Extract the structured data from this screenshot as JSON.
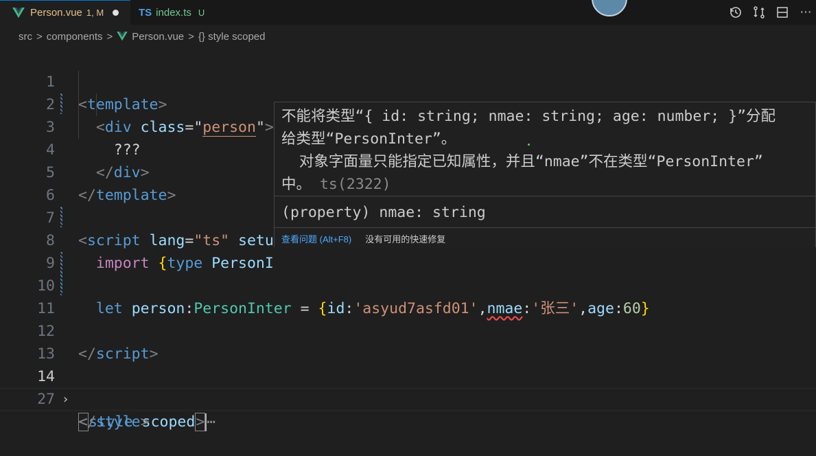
{
  "tabs": [
    {
      "label": "Person.vue",
      "status": "1, M",
      "icon": "vue-icon",
      "active": true
    },
    {
      "label": "index.ts",
      "status": "U",
      "icon_text": "TS"
    }
  ],
  "breadcrumb": {
    "items": [
      "src",
      "components",
      "Person.vue",
      "{} style scoped"
    ],
    "separator": ">"
  },
  "lines": [
    {
      "n": "1"
    },
    {
      "n": "2"
    },
    {
      "n": "3"
    },
    {
      "n": "4"
    },
    {
      "n": "5"
    },
    {
      "n": "6"
    },
    {
      "n": "7"
    },
    {
      "n": "8"
    },
    {
      "n": "9"
    },
    {
      "n": "10"
    },
    {
      "n": "11"
    },
    {
      "n": "12"
    },
    {
      "n": "13"
    },
    {
      "n": "14"
    },
    {
      "n": "27"
    }
  ],
  "code": {
    "l1": {
      "open": "<",
      "name": "template",
      "close": ">"
    },
    "l2": {
      "open": "<",
      "name": "div",
      "attr": "class",
      "eq": "=\"",
      "val": "person",
      "endq": "\"",
      "close": ">"
    },
    "l3": {
      "text": "???"
    },
    "l4": {
      "open": "</",
      "name": "div",
      "close": ">"
    },
    "l5": {
      "open": "</",
      "name": "template",
      "close": ">"
    },
    "l7": {
      "open": "<",
      "name": "script",
      "attr1": "lang",
      "eq": "=",
      "val": "\"ts\"",
      "attr2": "setu"
    },
    "l8": {
      "kw": "import",
      "brace": "{",
      "kw2": "type",
      "ident": "PersonI"
    },
    "l10": {
      "kw": "let",
      "var": "person",
      "colon": ":",
      "type": "PersonInter",
      "eq": " = ",
      "ob": "{",
      "k1": "id",
      "v1": "'asyud7asfd01'",
      "k2": "nmae",
      "v2": "'张三'",
      "k3": "age",
      "v3": "60",
      "cb": "}"
    },
    "l12": {
      "open": "</",
      "name": "script",
      "close": ">"
    },
    "l14": {
      "open": "<",
      "name": "style",
      "attr": "scoped",
      "close": ">",
      "ellipsis": "⋯"
    },
    "l27": {
      "open": "</",
      "name": "style",
      "close": ">"
    }
  },
  "hover": {
    "message_line1": "不能将类型“{ id: string; nmae: string; age: number; }”分配",
    "message_line2": "给类型“PersonInter”。",
    "message_line3": "  对象字面量只能指定已知属性，并且“nmae”不在类型“PersonInter”",
    "message_line4": "中。",
    "error_code": "ts(2322)",
    "property": "(property) nmae: string",
    "view_problem": "查看问题 (Alt+F8)",
    "no_fix": "没有可用的快速修复"
  },
  "colors": {
    "modified": "#e2c08d",
    "untracked": "#73c991",
    "tag": "#569cd6",
    "string": "#ce9178",
    "type": "#4ec9b0",
    "error": "#f14c4c"
  }
}
